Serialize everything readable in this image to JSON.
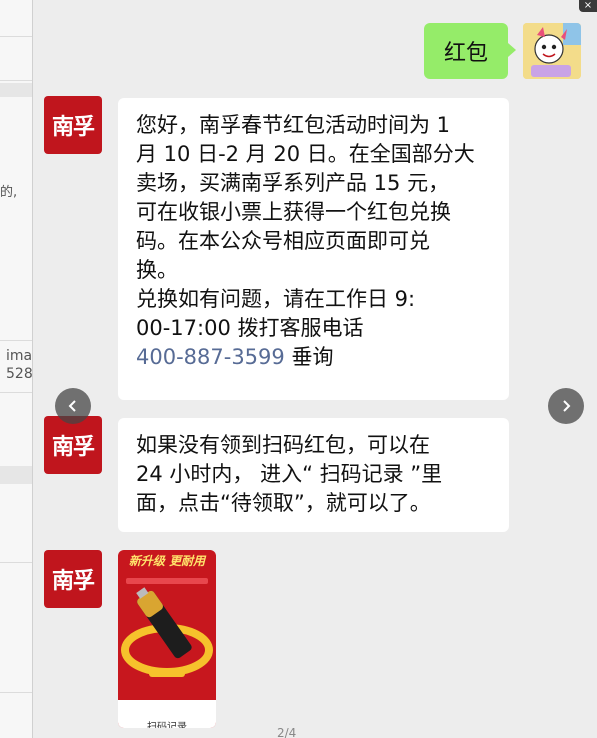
{
  "background_window": {
    "fragment_1": "的,",
    "fragment_2": "ima",
    "fragment_3": "528"
  },
  "viewer": {
    "close_symbol": "×",
    "pager": "2/4"
  },
  "messages": {
    "user_message": "红包",
    "brand_name": "南孚",
    "reply_1_lines": [
      "您好，南孚春节红包活动时间为 1",
      "月 10 日-2 月 20 日。在全国部分大",
      "卖场，买满南孚系列产品 15 元，",
      "可在收银小票上获得一个红包兑换",
      "码。在本公众号相应页面即可兑",
      "换。",
      "兑换如有问题，请在工作日 9:",
      "00-17:00 拨打客服电话"
    ],
    "reply_1_phone": "400-887-3599",
    "reply_1_suffix": " 垂询",
    "reply_2_lines": [
      "如果没有领到扫码红包，可以在",
      "24 小时内， 进入“ 扫码记录 ”里",
      "面，点击“待领取”，就可以了。"
    ],
    "poster_headline": "新升级 更耐用",
    "poster_bottom_label": "扫码记录"
  },
  "colors": {
    "brand_red": "#c0151d",
    "user_bubble": "#95ec69",
    "link": "#576b95"
  }
}
